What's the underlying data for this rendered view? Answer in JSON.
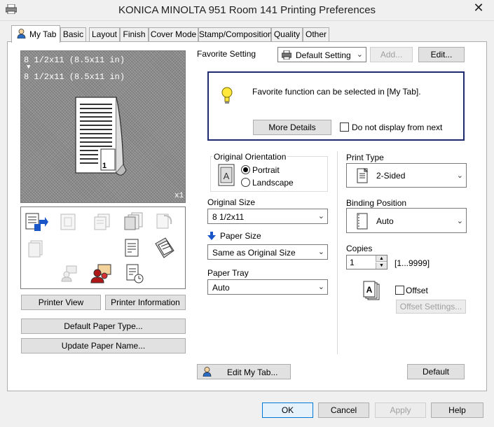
{
  "window": {
    "title": "KONICA MINOLTA 951 Room 141 Printing Preferences",
    "close_glyph": "✕"
  },
  "tabs": [
    {
      "label": "My Tab"
    },
    {
      "label": "Basic"
    },
    {
      "label": "Layout"
    },
    {
      "label": "Finish"
    },
    {
      "label": "Cover Mode"
    },
    {
      "label": "Stamp/Composition"
    },
    {
      "label": "Quality"
    },
    {
      "label": "Other"
    }
  ],
  "preview": {
    "line1": "8 1/2x11 (8.5x11 in)",
    "arrow": "▼",
    "line2": "8 1/2x11 (8.5x11 in)",
    "copies_badge": "x1",
    "page_number": "1"
  },
  "left_buttons": {
    "printer_view": "Printer View",
    "printer_information": "Printer Information",
    "default_paper_type": "Default Paper Type...",
    "update_paper_name": "Update Paper Name..."
  },
  "favorite": {
    "label": "Favorite Setting",
    "selected": "Default Setting",
    "add": "Add...",
    "edit": "Edit..."
  },
  "info_box": {
    "message": "Favorite function can be selected in [My Tab].",
    "more_details": "More Details",
    "do_not_display": "Do not display from next"
  },
  "orientation": {
    "title": "Original Orientation",
    "portrait": "Portrait",
    "landscape": "Landscape",
    "selected": "Portrait"
  },
  "original_size": {
    "label": "Original Size",
    "value": "8 1/2x11"
  },
  "paper_size": {
    "label": "Paper Size",
    "value": "Same as Original Size"
  },
  "paper_tray": {
    "label": "Paper Tray",
    "value": "Auto"
  },
  "print_type": {
    "label": "Print Type",
    "value": "2-Sided"
  },
  "binding_position": {
    "label": "Binding Position",
    "value": "Auto"
  },
  "copies": {
    "label": "Copies",
    "value": "1",
    "range": "[1...9999]"
  },
  "offset": {
    "label": "Offset",
    "settings": "Offset Settings..."
  },
  "bottom_tab_buttons": {
    "edit_my_tab": "Edit My Tab...",
    "default": "Default"
  },
  "dialog_buttons": {
    "ok": "OK",
    "cancel": "Cancel",
    "apply": "Apply",
    "help": "Help"
  },
  "colors": {
    "accent": "#0078d7",
    "focus_border": "#1e2a6e",
    "disabled_text": "#a0a0a0"
  }
}
